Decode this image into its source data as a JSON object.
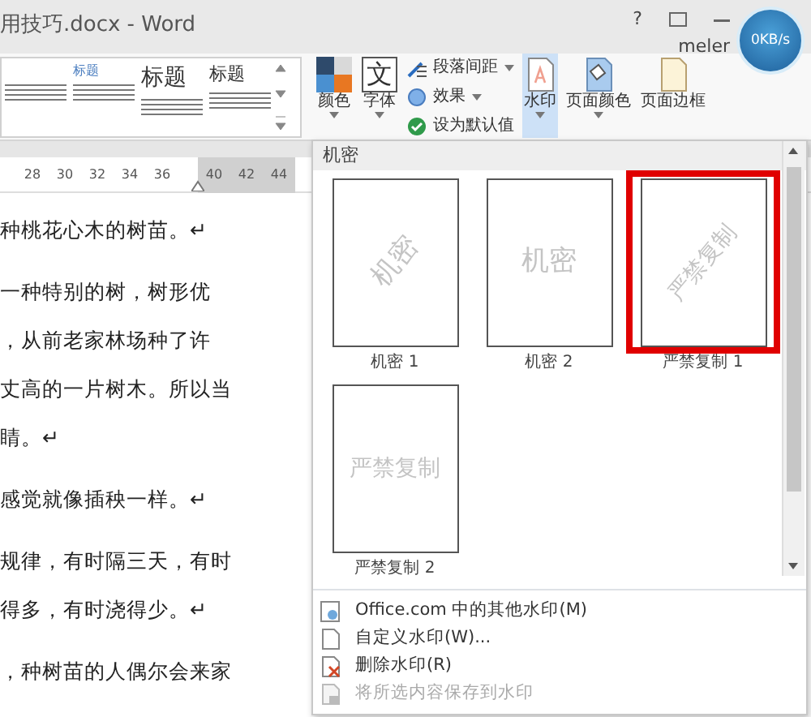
{
  "window": {
    "title": "用技巧.docx - Word",
    "help": "?",
    "user": "meler"
  },
  "speed_meter": {
    "reading": "0KB/s"
  },
  "ribbon": {
    "style_gallery": [
      {
        "kind": "plain"
      },
      {
        "heading": "标题",
        "kind": "small"
      },
      {
        "heading": "标题",
        "kind": "large"
      },
      {
        "heading": "标题",
        "kind": "medium"
      }
    ],
    "design_buttons": [
      {
        "label": "颜色",
        "kind": "colors"
      },
      {
        "label": "字体",
        "kind": "fonts",
        "glyph": "文"
      }
    ],
    "options": [
      {
        "label": "段落间距",
        "kind": "spacing",
        "dropdown": true
      },
      {
        "label": "效果",
        "kind": "effects",
        "dropdown": true
      },
      {
        "label": "设为默认值",
        "kind": "default",
        "dropdown": false
      }
    ],
    "background_buttons": [
      {
        "label": "水印",
        "kind": "watermark",
        "selected": true,
        "dropdown": true
      },
      {
        "label": "页面颜色",
        "kind": "color",
        "selected": false,
        "dropdown": true
      },
      {
        "label": "页面边框",
        "kind": "border",
        "selected": false,
        "dropdown": false
      }
    ]
  },
  "ruler": {
    "ticks": [
      {
        "label": "28",
        "margin": false
      },
      {
        "label": "30",
        "margin": false
      },
      {
        "label": "32",
        "margin": false
      },
      {
        "label": "34",
        "margin": false
      },
      {
        "label": "36",
        "margin": false
      },
      {
        "label": "40",
        "margin": true
      },
      {
        "label": "42",
        "margin": true
      },
      {
        "label": "44",
        "margin": true
      }
    ]
  },
  "document": {
    "paragraphs": [
      {
        "lines": [
          "种桃花心木的树苗。↵"
        ]
      },
      {
        "lines": [
          "一种特别的树，树形优",
          "，从前老家林场种了许",
          "丈高的一片树木。所以当",
          "睛。↵"
        ]
      },
      {
        "lines": [
          "感觉就像插秧一样。↵"
        ]
      },
      {
        "lines": [
          "规律，有时隔三天，有时",
          "得多，有时浇得少。↵"
        ]
      },
      {
        "lines": [
          "，种树苗的人偶尔会来家"
        ]
      }
    ]
  },
  "watermark_menu": {
    "section": "机密",
    "items": [
      {
        "label": "机密 1",
        "text": "机密",
        "kind": "diagonal",
        "selected": false
      },
      {
        "label": "机密 2",
        "text": "机密",
        "kind": "horizontal",
        "selected": false
      },
      {
        "label": "严禁复制 1",
        "text": "严禁复制",
        "kind": "diagonal",
        "selected": true
      },
      {
        "label": "严禁复制 2",
        "text": "严禁复制",
        "kind": "horizontal",
        "selected": false
      }
    ],
    "commands": [
      {
        "label": "Office.com 中的其他水印(M)",
        "kind": "online",
        "disabled": false
      },
      {
        "label": "自定义水印(W)...",
        "kind": "custom",
        "disabled": false
      },
      {
        "label": "删除水印(R)",
        "kind": "remove",
        "disabled": false
      },
      {
        "label": "将所选内容保存到水印",
        "kind": "save",
        "disabled": true
      }
    ]
  }
}
